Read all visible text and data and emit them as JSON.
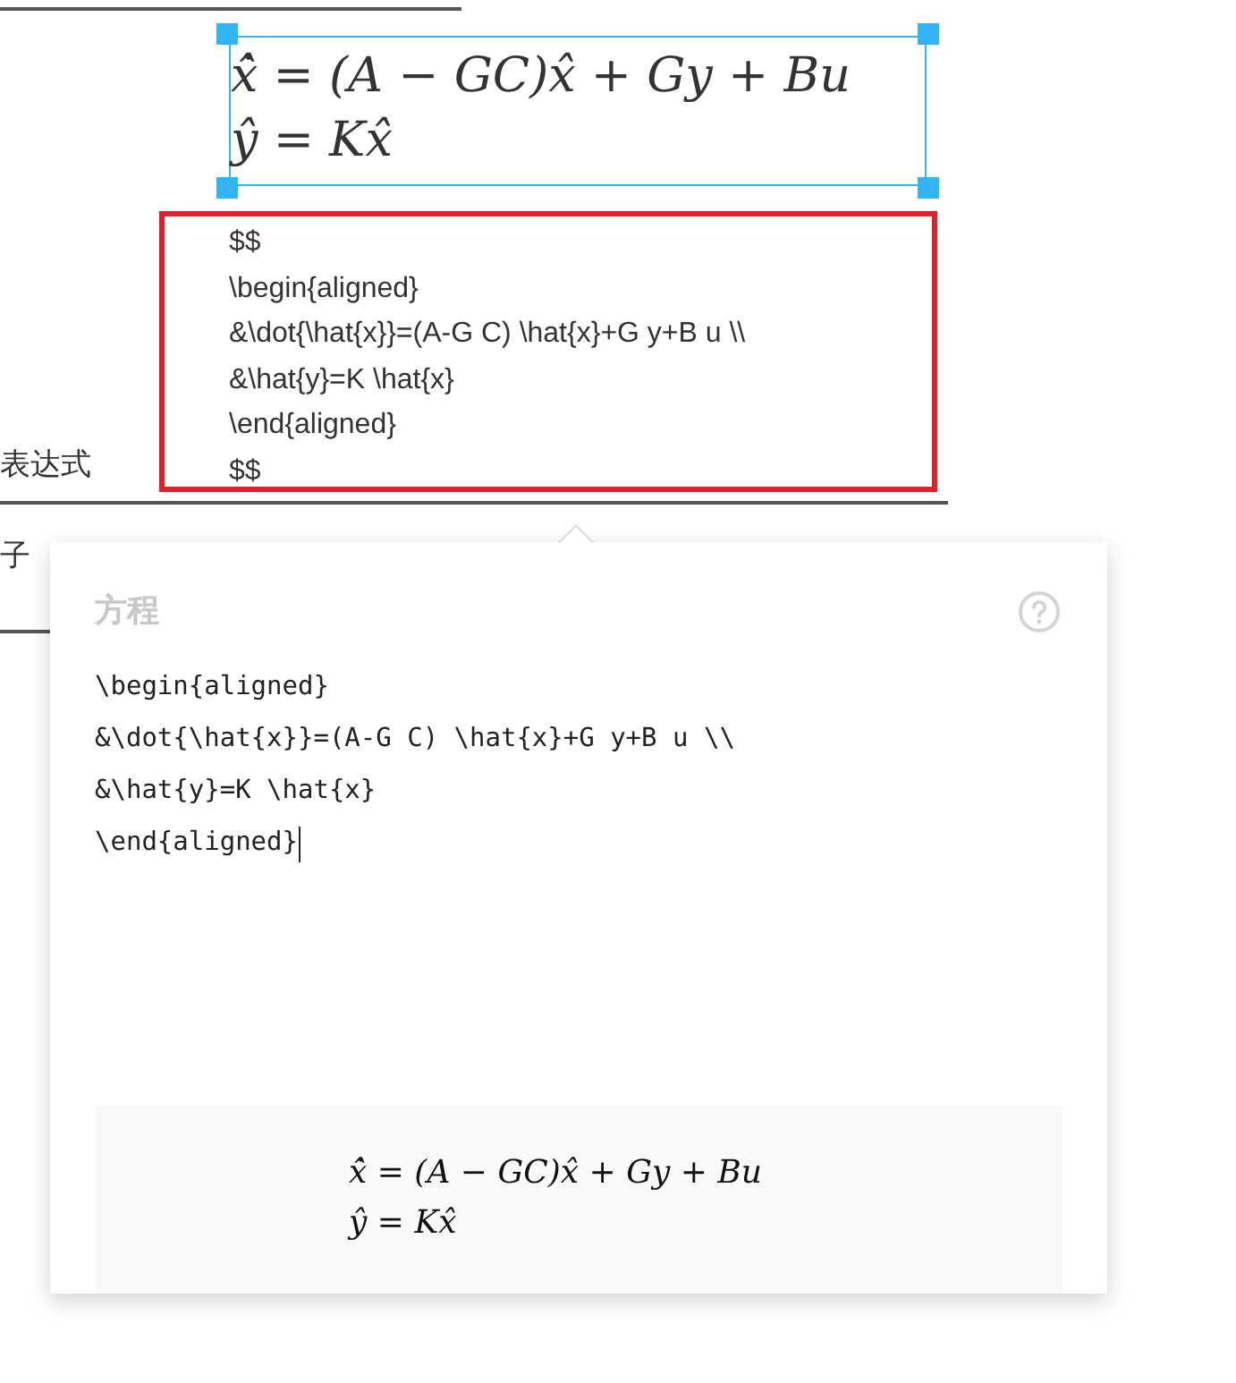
{
  "document": {
    "side_texts": [
      "表达式",
      "子"
    ],
    "math_block": {
      "selected": true,
      "rendered": [
        "ẋ̂ = (A − GC)x̂ + Gy + Bu",
        "ŷ = Kx̂"
      ],
      "source": [
        "$$",
        "\\begin{aligned}",
        "&\\dot{\\hat{x}}=(A-G C) \\hat{x}+G y+B u \\\\",
        "&\\hat{y}=K \\hat{x}",
        "\\end{aligned}",
        "$$"
      ]
    }
  },
  "popup": {
    "title": "方程",
    "source": [
      "\\begin{aligned}",
      "&\\dot{\\hat{x}}=(A-G C) \\hat{x}+G y+B u \\\\",
      "&\\hat{y}=K \\hat{x}",
      "\\end{aligned}"
    ],
    "preview": [
      "ẋ̂ = (A − GC)x̂ + Gy + Bu",
      "ŷ = Kx̂"
    ]
  }
}
